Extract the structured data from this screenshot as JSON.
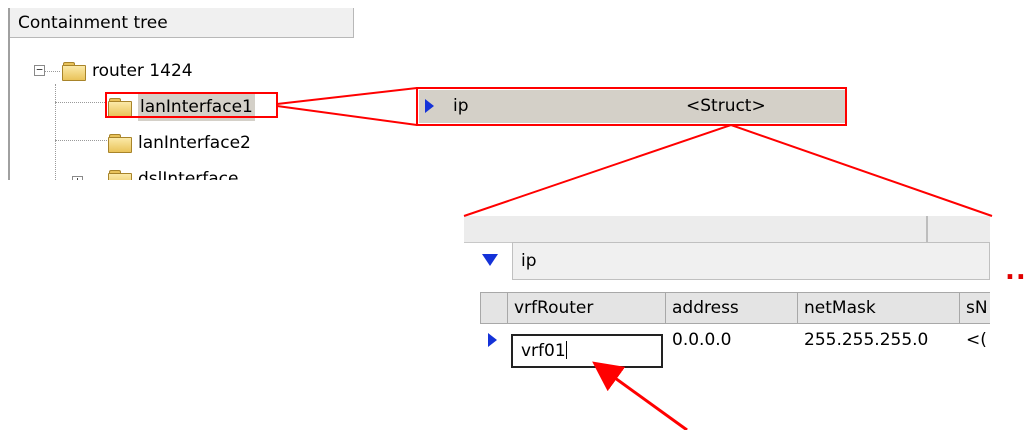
{
  "tree": {
    "header": "Containment tree",
    "nodes": [
      {
        "label": "router 1424",
        "expander": "−"
      },
      {
        "label": "lanInterface1"
      },
      {
        "label": "lanInterface2"
      },
      {
        "label": "dslInterface",
        "expander": "+"
      }
    ]
  },
  "struct_row": {
    "name": "ip",
    "type": "<Struct>"
  },
  "grid": {
    "title": "ip",
    "columns": [
      "vrfRouter",
      "address",
      "netMask",
      "sN"
    ],
    "row": {
      "vrfRouter": "vrf01",
      "address": "0.0.0.0",
      "netMask": "255.255.255.0",
      "sN": "<("
    }
  },
  "more_indicator": "..",
  "colors": {
    "callout": "#ff0000",
    "arrow_marker": "#1432d8",
    "selection": "#d4d0c8"
  }
}
